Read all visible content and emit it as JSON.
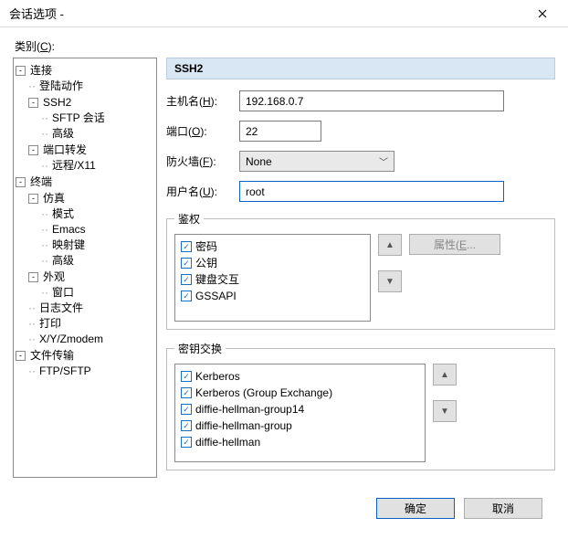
{
  "window": {
    "title": "会话选项 -"
  },
  "category_label_pre": "类别(",
  "category_label_key": "C",
  "category_label_post": "):",
  "tree": {
    "n0": "连接",
    "n0_0": "登陆动作",
    "n0_1": "SSH2",
    "n0_1_0": "SFTP 会话",
    "n0_1_1": "高级",
    "n0_2": "端口转发",
    "n0_2_0": "远程/X11",
    "n1": "终端",
    "n1_0": "仿真",
    "n1_0_0": "模式",
    "n1_0_1": "Emacs",
    "n1_0_2": "映射键",
    "n1_0_3": "高级",
    "n1_1": "外观",
    "n1_1_0": "窗口",
    "n1_2": "日志文件",
    "n1_3": "打印",
    "n1_4": "X/Y/Zmodem",
    "n2": "文件传输",
    "n2_0": "FTP/SFTP"
  },
  "panel": {
    "header": "SSH2"
  },
  "labels": {
    "host_pre": "主机名(",
    "host_key": "H",
    "host_post": "):",
    "port_pre": "端口(",
    "port_key": "O",
    "port_post": "):",
    "fw_pre": "防火墙(",
    "fw_key": "F",
    "fw_post": "):",
    "user_pre": "用户名(",
    "user_key": "U",
    "user_post": "):"
  },
  "values": {
    "host": "192.168.0.7",
    "port": "22",
    "firewall": "None",
    "username": "root"
  },
  "groups": {
    "auth_legend": "鉴权",
    "kex_legend": "密钥交换",
    "props_pre": "属性(",
    "props_key": "E",
    "props_post": "..."
  },
  "auth_items": {
    "i0": "密码",
    "i1": "公钥",
    "i2": "键盘交互",
    "i3": "GSSAPI"
  },
  "kex_items": {
    "i0": "Kerberos",
    "i1": "Kerberos (Group Exchange)",
    "i2": "diffie-hellman-group14",
    "i3": "diffie-hellman-group",
    "i4": "diffie-hellman"
  },
  "buttons": {
    "ok": "确定",
    "cancel": "取消"
  },
  "glyphs": {
    "up": "▲",
    "down": "▼"
  }
}
